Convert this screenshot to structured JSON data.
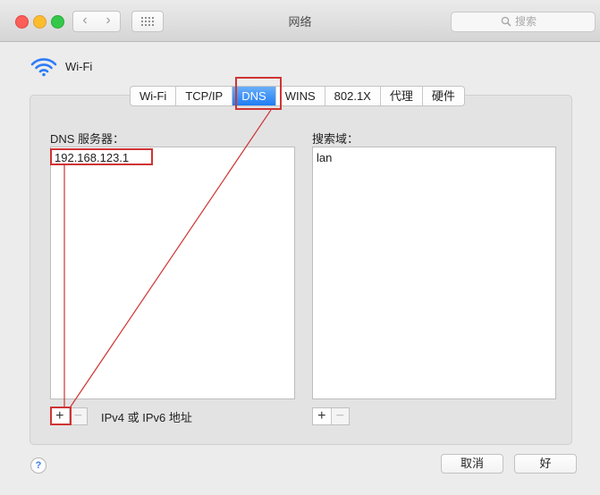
{
  "window": {
    "title": "网络",
    "search_placeholder": "搜索",
    "nav_back": "‹",
    "nav_forward": "›"
  },
  "interface": {
    "name": "Wi-Fi"
  },
  "tabs": [
    {
      "label": "Wi-Fi",
      "active": false
    },
    {
      "label": "TCP/IP",
      "active": false
    },
    {
      "label": "DNS",
      "active": true
    },
    {
      "label": "WINS",
      "active": false
    },
    {
      "label": "802.1X",
      "active": false
    },
    {
      "label": "代理",
      "active": false
    },
    {
      "label": "硬件",
      "active": false
    }
  ],
  "dns": {
    "servers_label": "DNS 服务器：",
    "servers": [
      "192.168.123.1"
    ],
    "add_symbol": "+",
    "remove_symbol": "−",
    "address_hint": "IPv4 或 IPv6 地址"
  },
  "search_domains": {
    "label": "搜索域：",
    "domains": [
      "lan"
    ],
    "add_symbol": "+",
    "remove_symbol": "−"
  },
  "footer": {
    "help_symbol": "?",
    "cancel_label": "取消",
    "ok_label": "好"
  },
  "colors": {
    "active_tab": "#1f7df5",
    "annotation_red": "#cf3434",
    "wifi_blue": "#2d7cf6"
  },
  "icons": {
    "wifi": "wifi-icon",
    "search": "search-icon",
    "grid": "grid-icon"
  }
}
